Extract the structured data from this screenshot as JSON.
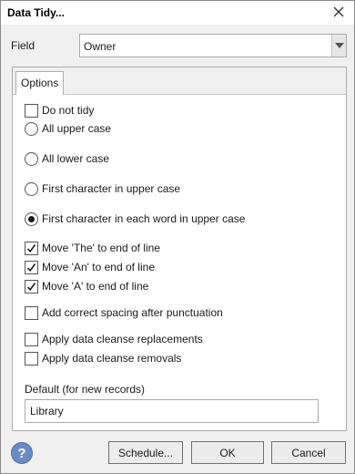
{
  "window": {
    "title": "Data Tidy..."
  },
  "field": {
    "label": "Field",
    "value": "Owner"
  },
  "tabs": [
    {
      "label": "Options"
    }
  ],
  "options": {
    "do_not_tidy": {
      "label": "Do not tidy",
      "checked": false
    },
    "case": [
      {
        "label": "All upper case",
        "selected": false
      },
      {
        "label": "All lower case",
        "selected": false
      },
      {
        "label": "First character in upper case",
        "selected": false
      },
      {
        "label": "First character in each word in upper case",
        "selected": true
      }
    ],
    "move_the": {
      "label": "Move 'The' to end of line",
      "checked": true
    },
    "move_an": {
      "label": "Move 'An' to end of line",
      "checked": true
    },
    "move_a": {
      "label": "Move 'A' to end of line",
      "checked": true
    },
    "spacing": {
      "label": "Add correct spacing after punctuation",
      "checked": false
    },
    "replacements": {
      "label": "Apply data cleanse replacements",
      "checked": false
    },
    "removals": {
      "label": "Apply data cleanse removals",
      "checked": false
    }
  },
  "default": {
    "label": "Default (for new records)",
    "value": "Library"
  },
  "buttons": {
    "help": "?",
    "schedule": "Schedule...",
    "ok": "OK",
    "cancel": "Cancel"
  },
  "icons": {
    "close": "close-icon",
    "dropdown": "chevron-down-icon",
    "help": "help-icon",
    "check": "check-icon"
  }
}
